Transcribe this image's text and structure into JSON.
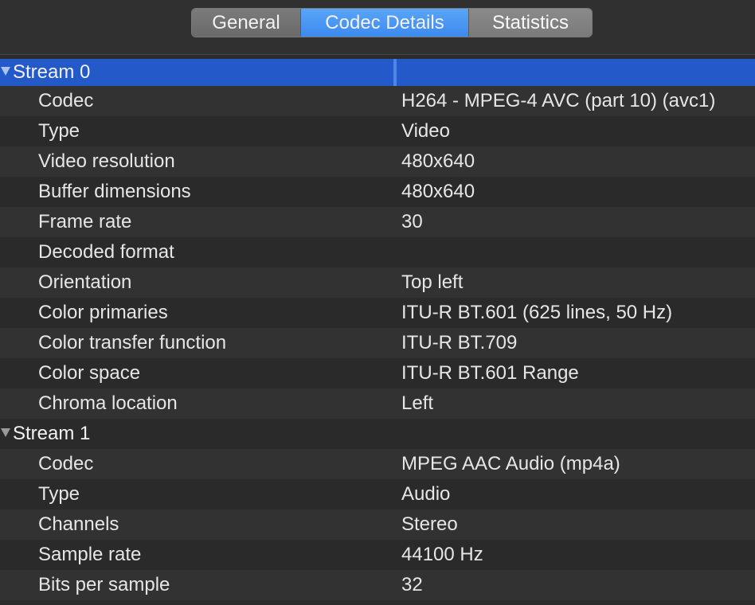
{
  "tabs": [
    {
      "label": "General",
      "selected": false
    },
    {
      "label": "Codec Details",
      "selected": true
    },
    {
      "label": "Statistics",
      "selected": false
    }
  ],
  "streams": [
    {
      "label": "Stream 0",
      "rows": [
        {
          "key": "Codec",
          "value": "H264 - MPEG-4 AVC (part 10) (avc1)"
        },
        {
          "key": "Type",
          "value": "Video"
        },
        {
          "key": "Video resolution",
          "value": "480x640"
        },
        {
          "key": "Buffer dimensions",
          "value": "480x640"
        },
        {
          "key": "Frame rate",
          "value": "30"
        },
        {
          "key": "Decoded format",
          "value": ""
        },
        {
          "key": "Orientation",
          "value": "Top left"
        },
        {
          "key": "Color primaries",
          "value": "ITU-R BT.601 (625 lines, 50 Hz)"
        },
        {
          "key": "Color transfer function",
          "value": "ITU-R BT.709"
        },
        {
          "key": "Color space",
          "value": "ITU-R BT.601 Range"
        },
        {
          "key": "Chroma location",
          "value": "Left"
        }
      ]
    },
    {
      "label": "Stream 1",
      "rows": [
        {
          "key": "Codec",
          "value": "MPEG AAC Audio (mp4a)"
        },
        {
          "key": "Type",
          "value": "Audio"
        },
        {
          "key": "Channels",
          "value": "Stereo"
        },
        {
          "key": "Sample rate",
          "value": "44100 Hz"
        },
        {
          "key": "Bits per sample",
          "value": "32"
        }
      ]
    }
  ],
  "colors": {
    "selection": "#2359c8",
    "tab_selected": "#3c8af0",
    "background": "#2b2b2b"
  }
}
